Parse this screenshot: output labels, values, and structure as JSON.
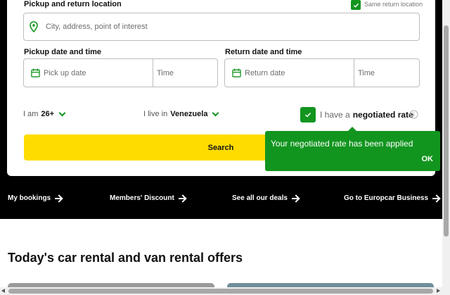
{
  "form": {
    "location_label": "Pickup and return location",
    "same_return_label": "Same return location",
    "same_return_checked": true,
    "location_placeholder": "City, address, point of interest",
    "pickup_label": "Pickup date and time",
    "pickup_date_placeholder": "Pick up date",
    "pickup_time_placeholder": "Time",
    "return_label": "Return date and time",
    "return_date_placeholder": "Return date",
    "return_time_placeholder": "Time",
    "age_prefix": "I am",
    "age_value": "26+",
    "residence_prefix": "I live in",
    "residence_value": "Venezuela",
    "negotiated_prefix": "I have a",
    "negotiated_bold": "negotiated rate",
    "negotiated_checked": true,
    "search_label": "Search"
  },
  "tooltip": {
    "message": "Your negotiated rate has been applied",
    "ok_label": "OK"
  },
  "nav": {
    "links": [
      "My bookings",
      "Members' Discount",
      "See all our deals",
      "Go to Europcar Business"
    ]
  },
  "offers": {
    "title": "Today's car rental and van rental offers"
  },
  "colors": {
    "accent_green": "#12951f",
    "search_yellow": "#ffdc00",
    "nav_background": "#000000"
  },
  "icons": [
    "location-pin-icon",
    "calendar-icon",
    "check-icon",
    "chevron-down-icon",
    "info-icon",
    "arrow-right-icon"
  ]
}
